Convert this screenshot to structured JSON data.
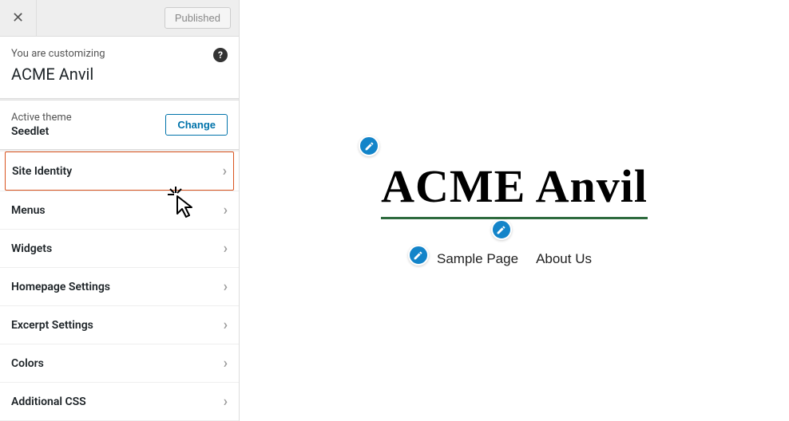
{
  "topbar": {
    "publish_label": "Published"
  },
  "header": {
    "customize_label": "You are customizing",
    "site_name": "ACME Anvil"
  },
  "theme": {
    "label": "Active theme",
    "name": "Seedlet",
    "change_label": "Change"
  },
  "menu": {
    "items": [
      {
        "label": "Site Identity",
        "active": true
      },
      {
        "label": "Menus",
        "active": false
      },
      {
        "label": "Widgets",
        "active": false
      },
      {
        "label": "Homepage Settings",
        "active": false
      },
      {
        "label": "Excerpt Settings",
        "active": false
      },
      {
        "label": "Colors",
        "active": false
      },
      {
        "label": "Additional CSS",
        "active": false
      }
    ]
  },
  "preview": {
    "title": "ACME Anvil",
    "nav": [
      "Sample Page",
      "About Us"
    ]
  }
}
